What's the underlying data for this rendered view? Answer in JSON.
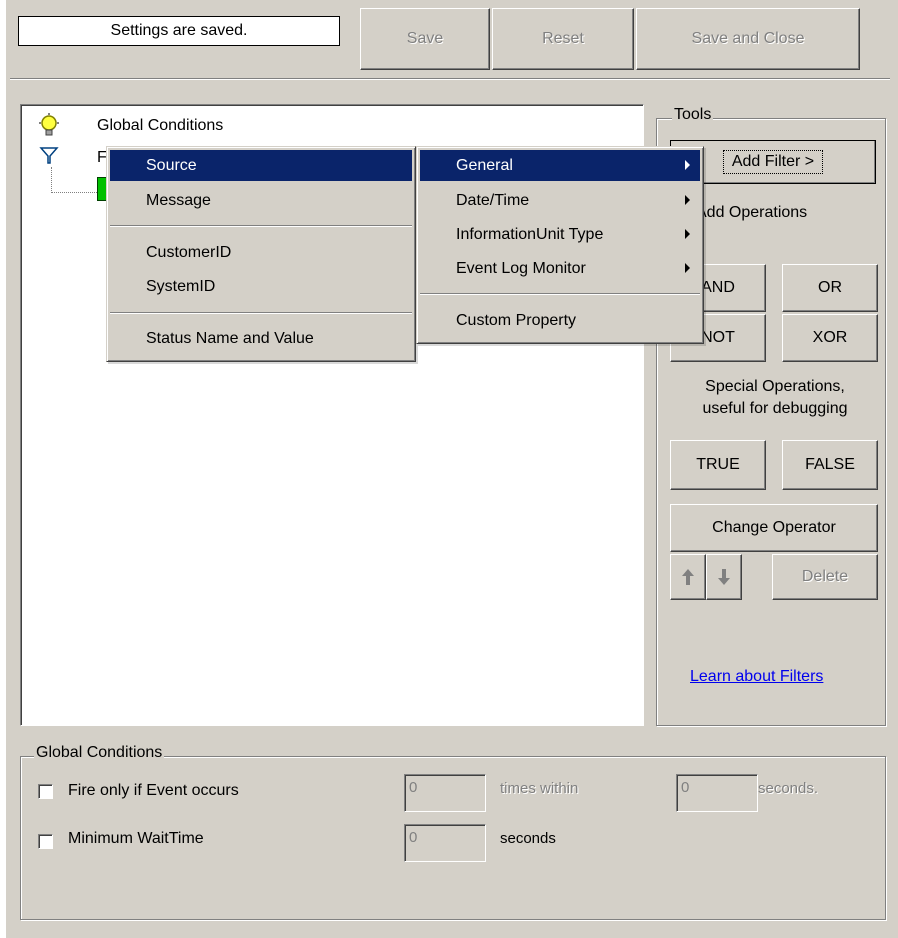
{
  "status": {
    "text": "Settings are saved."
  },
  "toolbar": {
    "save": "Save",
    "reset": "Reset",
    "save_close": "Save and Close"
  },
  "tree": {
    "global_conditions": "Global Conditions",
    "filters_partial": "F"
  },
  "context_menu": {
    "items": [
      "Source",
      "Message",
      "CustomerID",
      "SystemID",
      "Status Name and Value"
    ]
  },
  "submenu": {
    "items": [
      "General",
      "Date/Time",
      "InformationUnit Type",
      "Event Log Monitor",
      "Custom Property"
    ]
  },
  "tools": {
    "title": "Tools",
    "add_filter": "Add Filter >",
    "add_operations": "Add Operations",
    "and": "AND",
    "or": "OR",
    "not": "NOT",
    "xor": "XOR",
    "special_ops_line1": "Special Operations,",
    "special_ops_line2": "useful for debugging",
    "true": "TRUE",
    "false": "FALSE",
    "change_operator": "Change Operator",
    "delete": "Delete",
    "learn_link": "Learn about Filters"
  },
  "global_conditions": {
    "title": "Global Conditions",
    "fire_only": "Fire only if Event occurs",
    "fire_count": "0",
    "times_within": "times within",
    "fire_seconds": "0",
    "seconds_dot": "seconds.",
    "min_wait": "Minimum WaitTime",
    "min_wait_value": "0",
    "seconds": "seconds"
  },
  "colors": {
    "menu_highlight": "#0a246a",
    "face": "#d4d0c8",
    "link": "#0000ee"
  }
}
